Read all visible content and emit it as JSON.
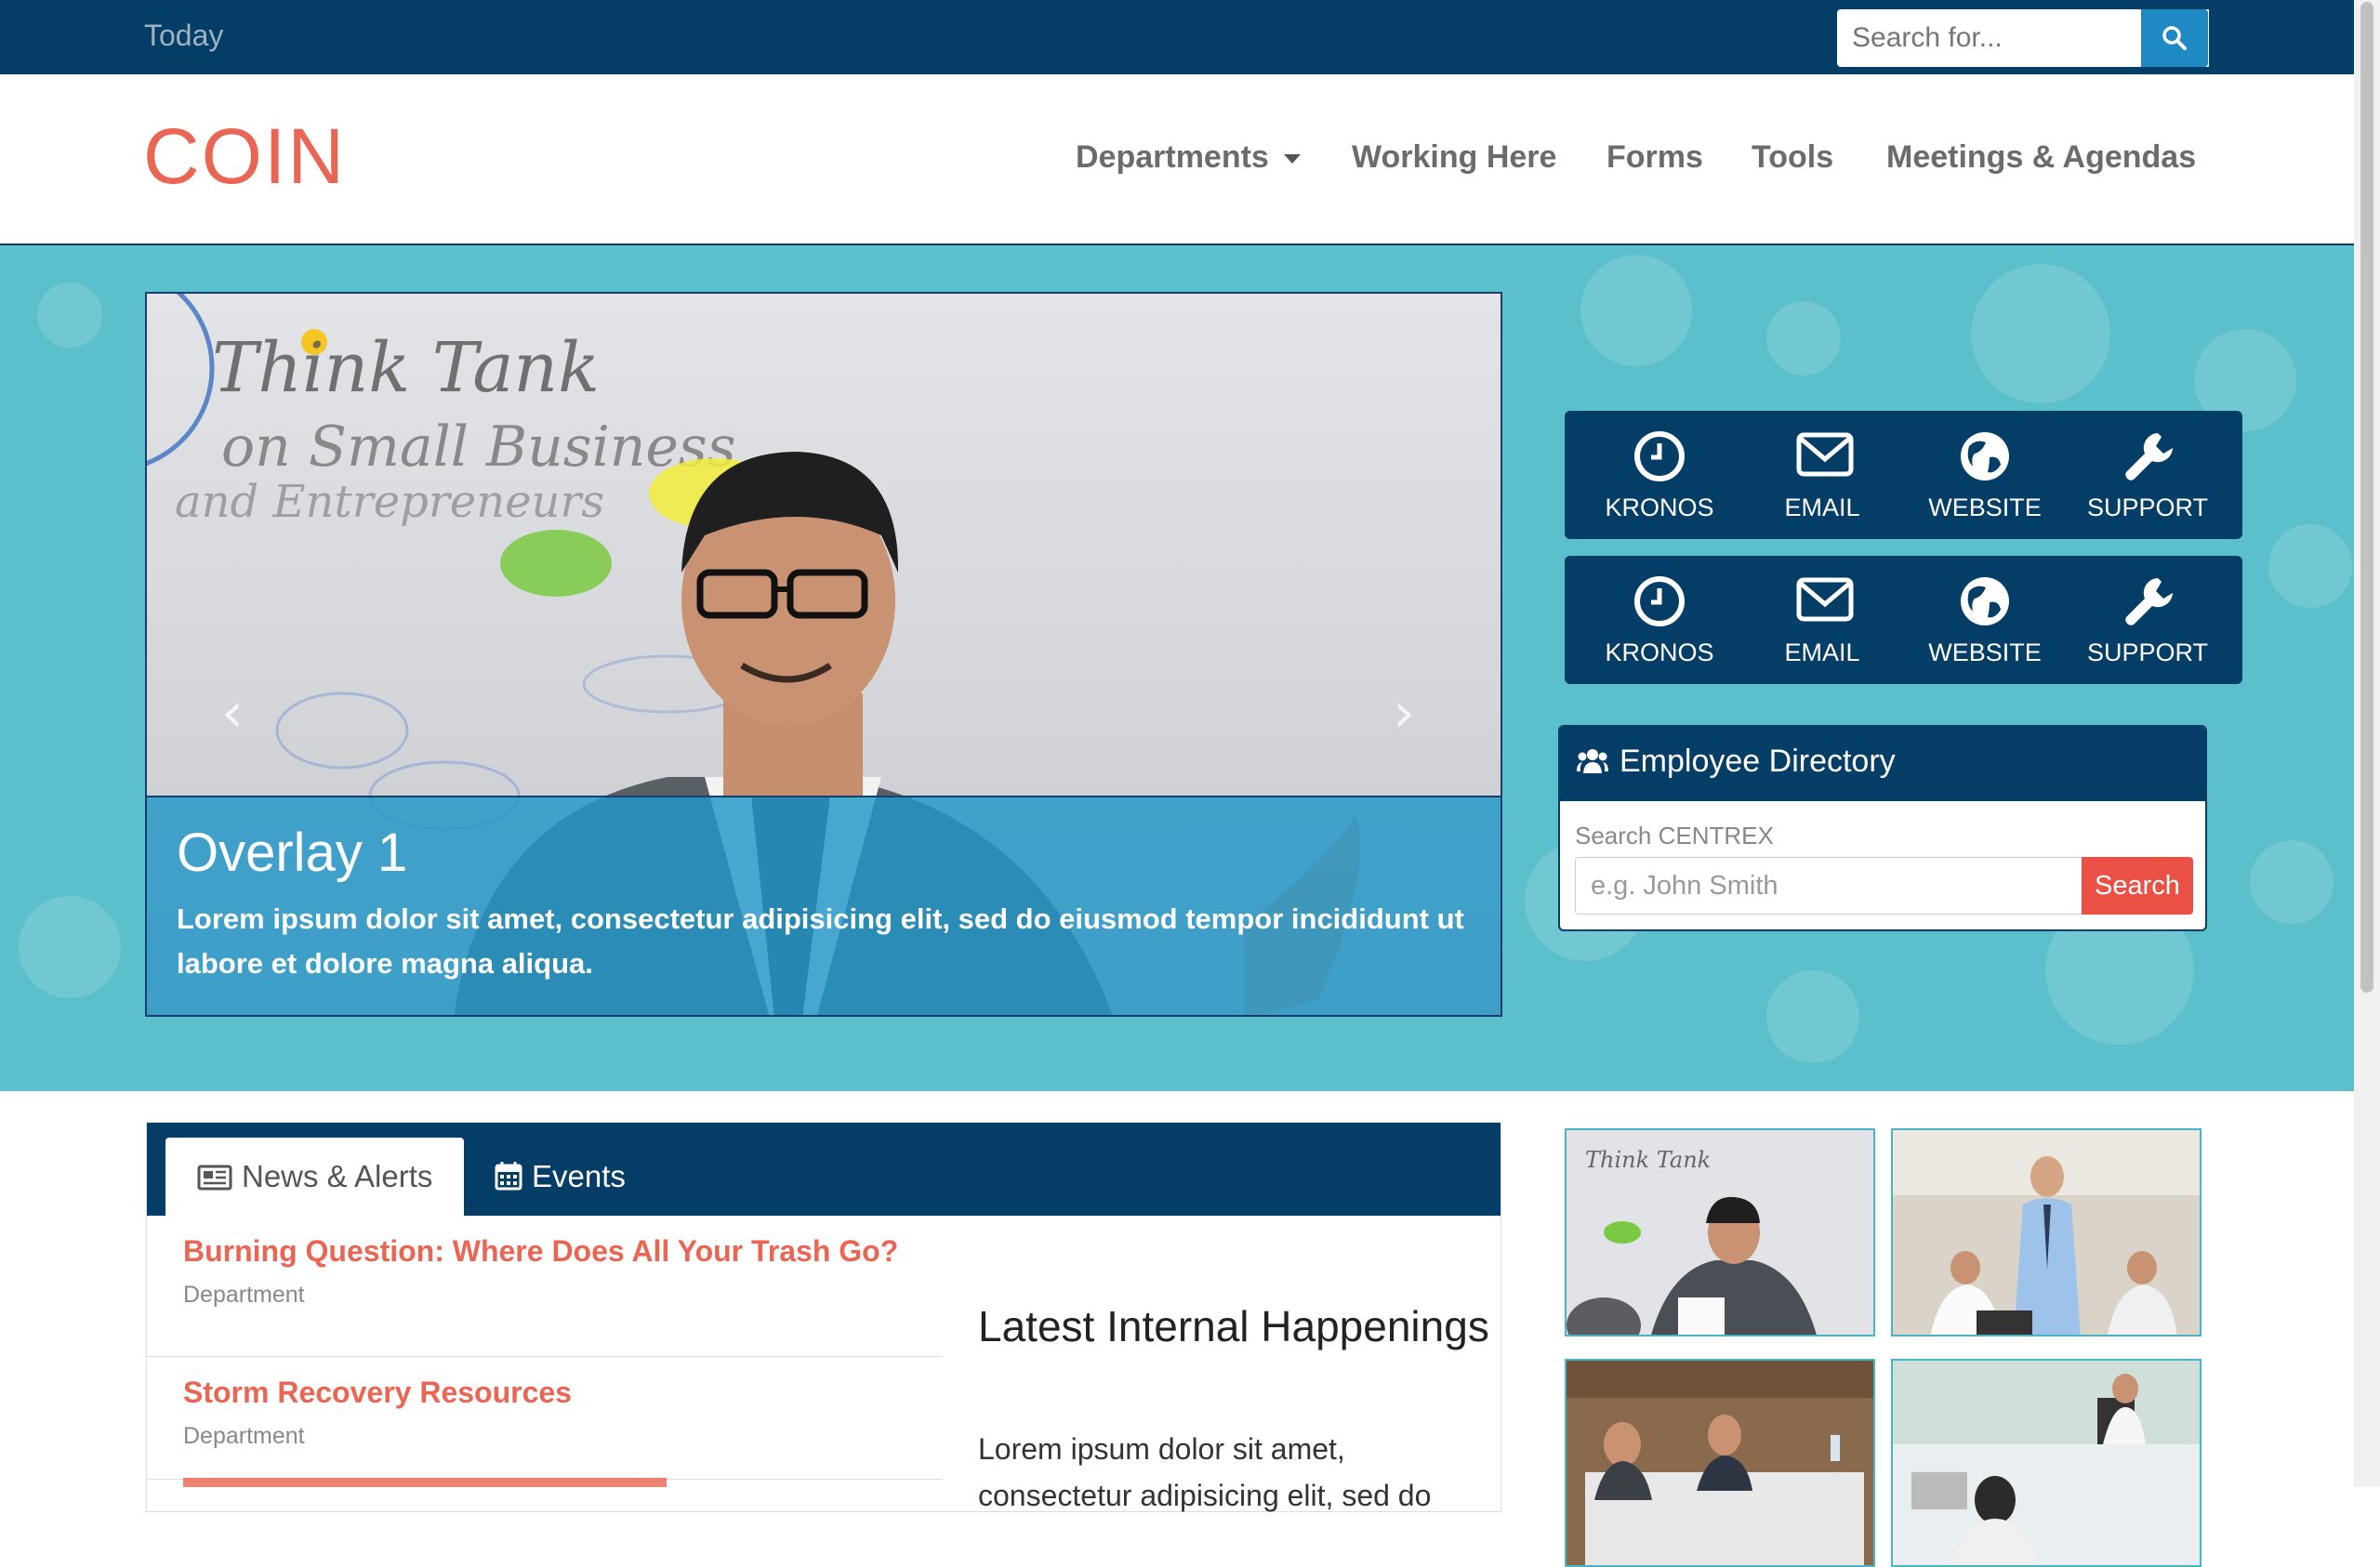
{
  "topbar": {
    "date_label": "Today",
    "search_placeholder": "Search for..."
  },
  "brand": {
    "logo": "COIN"
  },
  "nav": {
    "items": [
      "Departments",
      "Working Here",
      "Forms",
      "Tools",
      "Meetings & Agendas"
    ]
  },
  "hero": {
    "slide_title": "Overlay 1",
    "slide_text": "Lorem ipsum dolor sit amet, consectetur adipisicing elit, sed do eiusmod tempor incididunt ut labore et dolore magna aliqua.",
    "whiteboard_text": [
      "Think Tank",
      "on Small Business",
      "and Entrepreneurs"
    ]
  },
  "quick_links": [
    "KRONOS",
    "EMAIL",
    "WEBSITE",
    "SUPPORT",
    "KRONOS",
    "EMAIL",
    "WEBSITE",
    "SUPPORT"
  ],
  "directory": {
    "title": "Employee Directory",
    "label": "Search CENTREX",
    "placeholder": "e.g. John Smith",
    "button": "Search"
  },
  "tabs": [
    "News & Alerts",
    "Events"
  ],
  "news": [
    {
      "title": "Burning Question: Where Does All Your Trash Go?",
      "dept": "Department"
    },
    {
      "title": "Storm Recovery Resources",
      "dept": "Department"
    }
  ],
  "latest": {
    "title": "Latest Internal Happenings",
    "text": "Lorem ipsum dolor sit amet, consectetur adipisicing elit, sed do"
  },
  "colors": {
    "navy": "#043e66",
    "coral": "#ea6554",
    "teal": "#5cbfcc",
    "search_blue": "#1f89c4",
    "search_red": "#ea5044"
  }
}
